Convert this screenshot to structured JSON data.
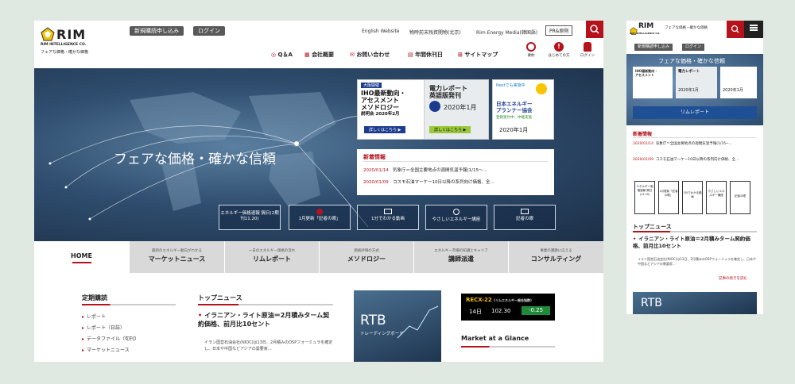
{
  "brand": {
    "logo": "RIM",
    "logo_sub": "RIM INTELLIGENCE CO.",
    "tagline": "フェアな価格・確かな価格"
  },
  "top": {
    "register": "新規購読申し込み",
    "login": "ログイン",
    "links": [
      "English Website",
      "物時前末残資開物(北京)",
      "Rim Energy Media(韓国語)"
    ],
    "pr": "PR&原則"
  },
  "nav": {
    "items": [
      "Q＆A",
      "会社概要",
      "お問い合わせ",
      "年間休刊日",
      "サイトマップ"
    ],
    "icons": [
      "要約",
      "はじめての方",
      "ログイン"
    ]
  },
  "hero": {
    "headline": "フェアな価格・確かな信頼",
    "banner1": {
      "tag": "大阪開催",
      "text": [
        "IHO最新動向・",
        "アセスメント",
        "メソドロジー",
        "説明会 2020年2月"
      ],
      "btn": "詳しくはこちら ▶"
    },
    "banner2": {
      "title": "電力レポート",
      "title2": "英語版発刊",
      "year": "2020年1月",
      "btn": "詳しくはこちら ▶"
    },
    "banner3": {
      "tag": "Nextでも実施中",
      "text": [
        "日本エネルギー",
        "プランナー協会"
      ],
      "sub": "登録受付中、中継実施",
      "year": "2020年1月"
    },
    "news_title": "新着情報",
    "news": [
      {
        "date": "2020/01/14",
        "text": "気象庁＝全国主要地点の週間気温予報(1/15～..."
      },
      {
        "date": "2020/01/09",
        "text": "コスモ石油マーケー10日以降の系列向け価格、全..."
      }
    ],
    "tiles": [
      "エネルギー価格速報 隔日(2期刊11.20)",
      "1月更新「記者の眼」",
      "1分でわかる動画",
      "やさしいエネルギー講座",
      "記者の眼"
    ]
  },
  "menu": [
    {
      "sub": "",
      "main": "HOME"
    },
    {
      "sub": "最新のエネルギー動向がわかる",
      "main": "マーケットニュース"
    },
    {
      "sub": "一日のエネルギー価格の流れ",
      "main": "リムレポート"
    },
    {
      "sub": "価格評価の方式",
      "main": "メソドロジー"
    },
    {
      "sub": "エネルギー市場の知識とキャリア",
      "main": "講師派遣"
    },
    {
      "sub": "事業の課題に応える",
      "main": "コンサルティング"
    }
  ],
  "sidebar": {
    "title": "定期購読",
    "items": [
      "レポート",
      "レポート（日誌）",
      "データファイル（旬刊）",
      "マーケットニュース"
    ]
  },
  "topnews": {
    "title": "トップニュース",
    "headline": "イラニアン・ライト原油＝2月積みターム契約価格、前月比10セント",
    "body": "イラン国営石油会社(NIOC)は13日、2月積みのOSPフォーミュラを確定し、日本や中国などアジアの需要家…"
  },
  "rtb": {
    "title": "RTB",
    "sub": "トレーディングボード"
  },
  "recx": {
    "title": "RECX-22",
    "title_tag": "(リムエネルギー総合指数)",
    "date": "14日",
    "value": "102.30",
    "change": "-0.25"
  },
  "market": {
    "title": "Market at a Glance"
  },
  "mobile": {
    "register": "新規購読申し込み",
    "login": "ログイン",
    "hero_text": "フェアな価格・確かな信頼",
    "rim_btn": "リムレポート",
    "news_title": "新着情報",
    "news": [
      {
        "date": "2020/01/14",
        "text": "気象庁＝全国主要地点の週間気温予報(1/15~..."
      },
      {
        "date": "2020/01/09",
        "text": "コスモ石油マーケー10日以降の系列向け価格、全..."
      }
    ],
    "tiles": [
      "エネルギー価格速報 隔日(11.20)",
      "1月更新「記者の眼」",
      "1分でわかる動画",
      "やさしいエネルギー講座",
      "記者の眼"
    ],
    "topnews_title": "トップニュース",
    "headline": "イラニアン・ライト原油＝2月積みターム契約価格、前月比10セント",
    "body": "イラン国営石油会社(NIOC)は13日、2月積みのOSPフォーミュラを確定し、日本や中国などアジアの需要家…",
    "more": "記事の続きを読む",
    "rtb": "RTB"
  }
}
